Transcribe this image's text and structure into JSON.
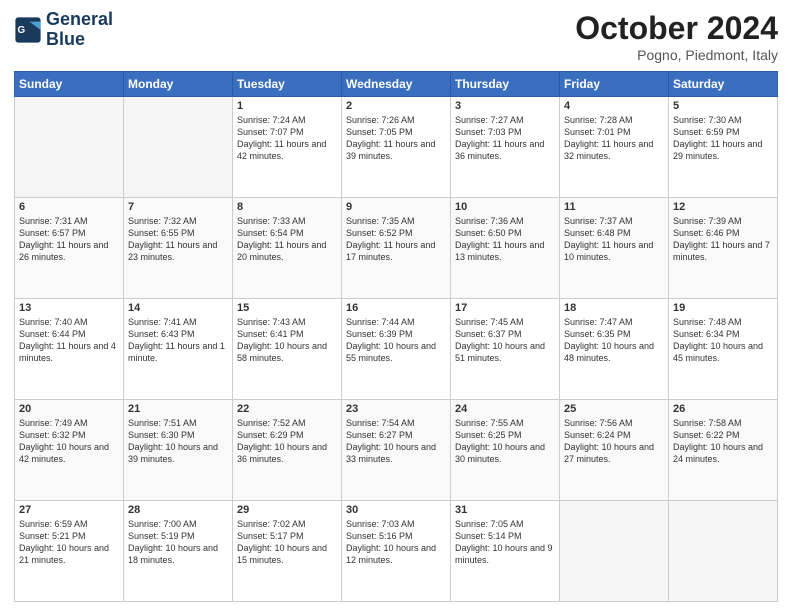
{
  "header": {
    "title": "October 2024",
    "subtitle": "Pogno, Piedmont, Italy"
  },
  "calendar": {
    "days": [
      "Sunday",
      "Monday",
      "Tuesday",
      "Wednesday",
      "Thursday",
      "Friday",
      "Saturday"
    ]
  },
  "weeks": [
    [
      {
        "day": "",
        "empty": true
      },
      {
        "day": "",
        "empty": true
      },
      {
        "day": "1",
        "line1": "Sunrise: 7:24 AM",
        "line2": "Sunset: 7:07 PM",
        "line3": "Daylight: 11 hours and 42 minutes."
      },
      {
        "day": "2",
        "line1": "Sunrise: 7:26 AM",
        "line2": "Sunset: 7:05 PM",
        "line3": "Daylight: 11 hours and 39 minutes."
      },
      {
        "day": "3",
        "line1": "Sunrise: 7:27 AM",
        "line2": "Sunset: 7:03 PM",
        "line3": "Daylight: 11 hours and 36 minutes."
      },
      {
        "day": "4",
        "line1": "Sunrise: 7:28 AM",
        "line2": "Sunset: 7:01 PM",
        "line3": "Daylight: 11 hours and 32 minutes."
      },
      {
        "day": "5",
        "line1": "Sunrise: 7:30 AM",
        "line2": "Sunset: 6:59 PM",
        "line3": "Daylight: 11 hours and 29 minutes."
      }
    ],
    [
      {
        "day": "6",
        "line1": "Sunrise: 7:31 AM",
        "line2": "Sunset: 6:57 PM",
        "line3": "Daylight: 11 hours and 26 minutes."
      },
      {
        "day": "7",
        "line1": "Sunrise: 7:32 AM",
        "line2": "Sunset: 6:55 PM",
        "line3": "Daylight: 11 hours and 23 minutes."
      },
      {
        "day": "8",
        "line1": "Sunrise: 7:33 AM",
        "line2": "Sunset: 6:54 PM",
        "line3": "Daylight: 11 hours and 20 minutes."
      },
      {
        "day": "9",
        "line1": "Sunrise: 7:35 AM",
        "line2": "Sunset: 6:52 PM",
        "line3": "Daylight: 11 hours and 17 minutes."
      },
      {
        "day": "10",
        "line1": "Sunrise: 7:36 AM",
        "line2": "Sunset: 6:50 PM",
        "line3": "Daylight: 11 hours and 13 minutes."
      },
      {
        "day": "11",
        "line1": "Sunrise: 7:37 AM",
        "line2": "Sunset: 6:48 PM",
        "line3": "Daylight: 11 hours and 10 minutes."
      },
      {
        "day": "12",
        "line1": "Sunrise: 7:39 AM",
        "line2": "Sunset: 6:46 PM",
        "line3": "Daylight: 11 hours and 7 minutes."
      }
    ],
    [
      {
        "day": "13",
        "line1": "Sunrise: 7:40 AM",
        "line2": "Sunset: 6:44 PM",
        "line3": "Daylight: 11 hours and 4 minutes."
      },
      {
        "day": "14",
        "line1": "Sunrise: 7:41 AM",
        "line2": "Sunset: 6:43 PM",
        "line3": "Daylight: 11 hours and 1 minute."
      },
      {
        "day": "15",
        "line1": "Sunrise: 7:43 AM",
        "line2": "Sunset: 6:41 PM",
        "line3": "Daylight: 10 hours and 58 minutes."
      },
      {
        "day": "16",
        "line1": "Sunrise: 7:44 AM",
        "line2": "Sunset: 6:39 PM",
        "line3": "Daylight: 10 hours and 55 minutes."
      },
      {
        "day": "17",
        "line1": "Sunrise: 7:45 AM",
        "line2": "Sunset: 6:37 PM",
        "line3": "Daylight: 10 hours and 51 minutes."
      },
      {
        "day": "18",
        "line1": "Sunrise: 7:47 AM",
        "line2": "Sunset: 6:35 PM",
        "line3": "Daylight: 10 hours and 48 minutes."
      },
      {
        "day": "19",
        "line1": "Sunrise: 7:48 AM",
        "line2": "Sunset: 6:34 PM",
        "line3": "Daylight: 10 hours and 45 minutes."
      }
    ],
    [
      {
        "day": "20",
        "line1": "Sunrise: 7:49 AM",
        "line2": "Sunset: 6:32 PM",
        "line3": "Daylight: 10 hours and 42 minutes."
      },
      {
        "day": "21",
        "line1": "Sunrise: 7:51 AM",
        "line2": "Sunset: 6:30 PM",
        "line3": "Daylight: 10 hours and 39 minutes."
      },
      {
        "day": "22",
        "line1": "Sunrise: 7:52 AM",
        "line2": "Sunset: 6:29 PM",
        "line3": "Daylight: 10 hours and 36 minutes."
      },
      {
        "day": "23",
        "line1": "Sunrise: 7:54 AM",
        "line2": "Sunset: 6:27 PM",
        "line3": "Daylight: 10 hours and 33 minutes."
      },
      {
        "day": "24",
        "line1": "Sunrise: 7:55 AM",
        "line2": "Sunset: 6:25 PM",
        "line3": "Daylight: 10 hours and 30 minutes."
      },
      {
        "day": "25",
        "line1": "Sunrise: 7:56 AM",
        "line2": "Sunset: 6:24 PM",
        "line3": "Daylight: 10 hours and 27 minutes."
      },
      {
        "day": "26",
        "line1": "Sunrise: 7:58 AM",
        "line2": "Sunset: 6:22 PM",
        "line3": "Daylight: 10 hours and 24 minutes."
      }
    ],
    [
      {
        "day": "27",
        "line1": "Sunrise: 6:59 AM",
        "line2": "Sunset: 5:21 PM",
        "line3": "Daylight: 10 hours and 21 minutes."
      },
      {
        "day": "28",
        "line1": "Sunrise: 7:00 AM",
        "line2": "Sunset: 5:19 PM",
        "line3": "Daylight: 10 hours and 18 minutes."
      },
      {
        "day": "29",
        "line1": "Sunrise: 7:02 AM",
        "line2": "Sunset: 5:17 PM",
        "line3": "Daylight: 10 hours and 15 minutes."
      },
      {
        "day": "30",
        "line1": "Sunrise: 7:03 AM",
        "line2": "Sunset: 5:16 PM",
        "line3": "Daylight: 10 hours and 12 minutes."
      },
      {
        "day": "31",
        "line1": "Sunrise: 7:05 AM",
        "line2": "Sunset: 5:14 PM",
        "line3": "Daylight: 10 hours and 9 minutes."
      },
      {
        "day": "",
        "empty": true
      },
      {
        "day": "",
        "empty": true
      }
    ]
  ]
}
